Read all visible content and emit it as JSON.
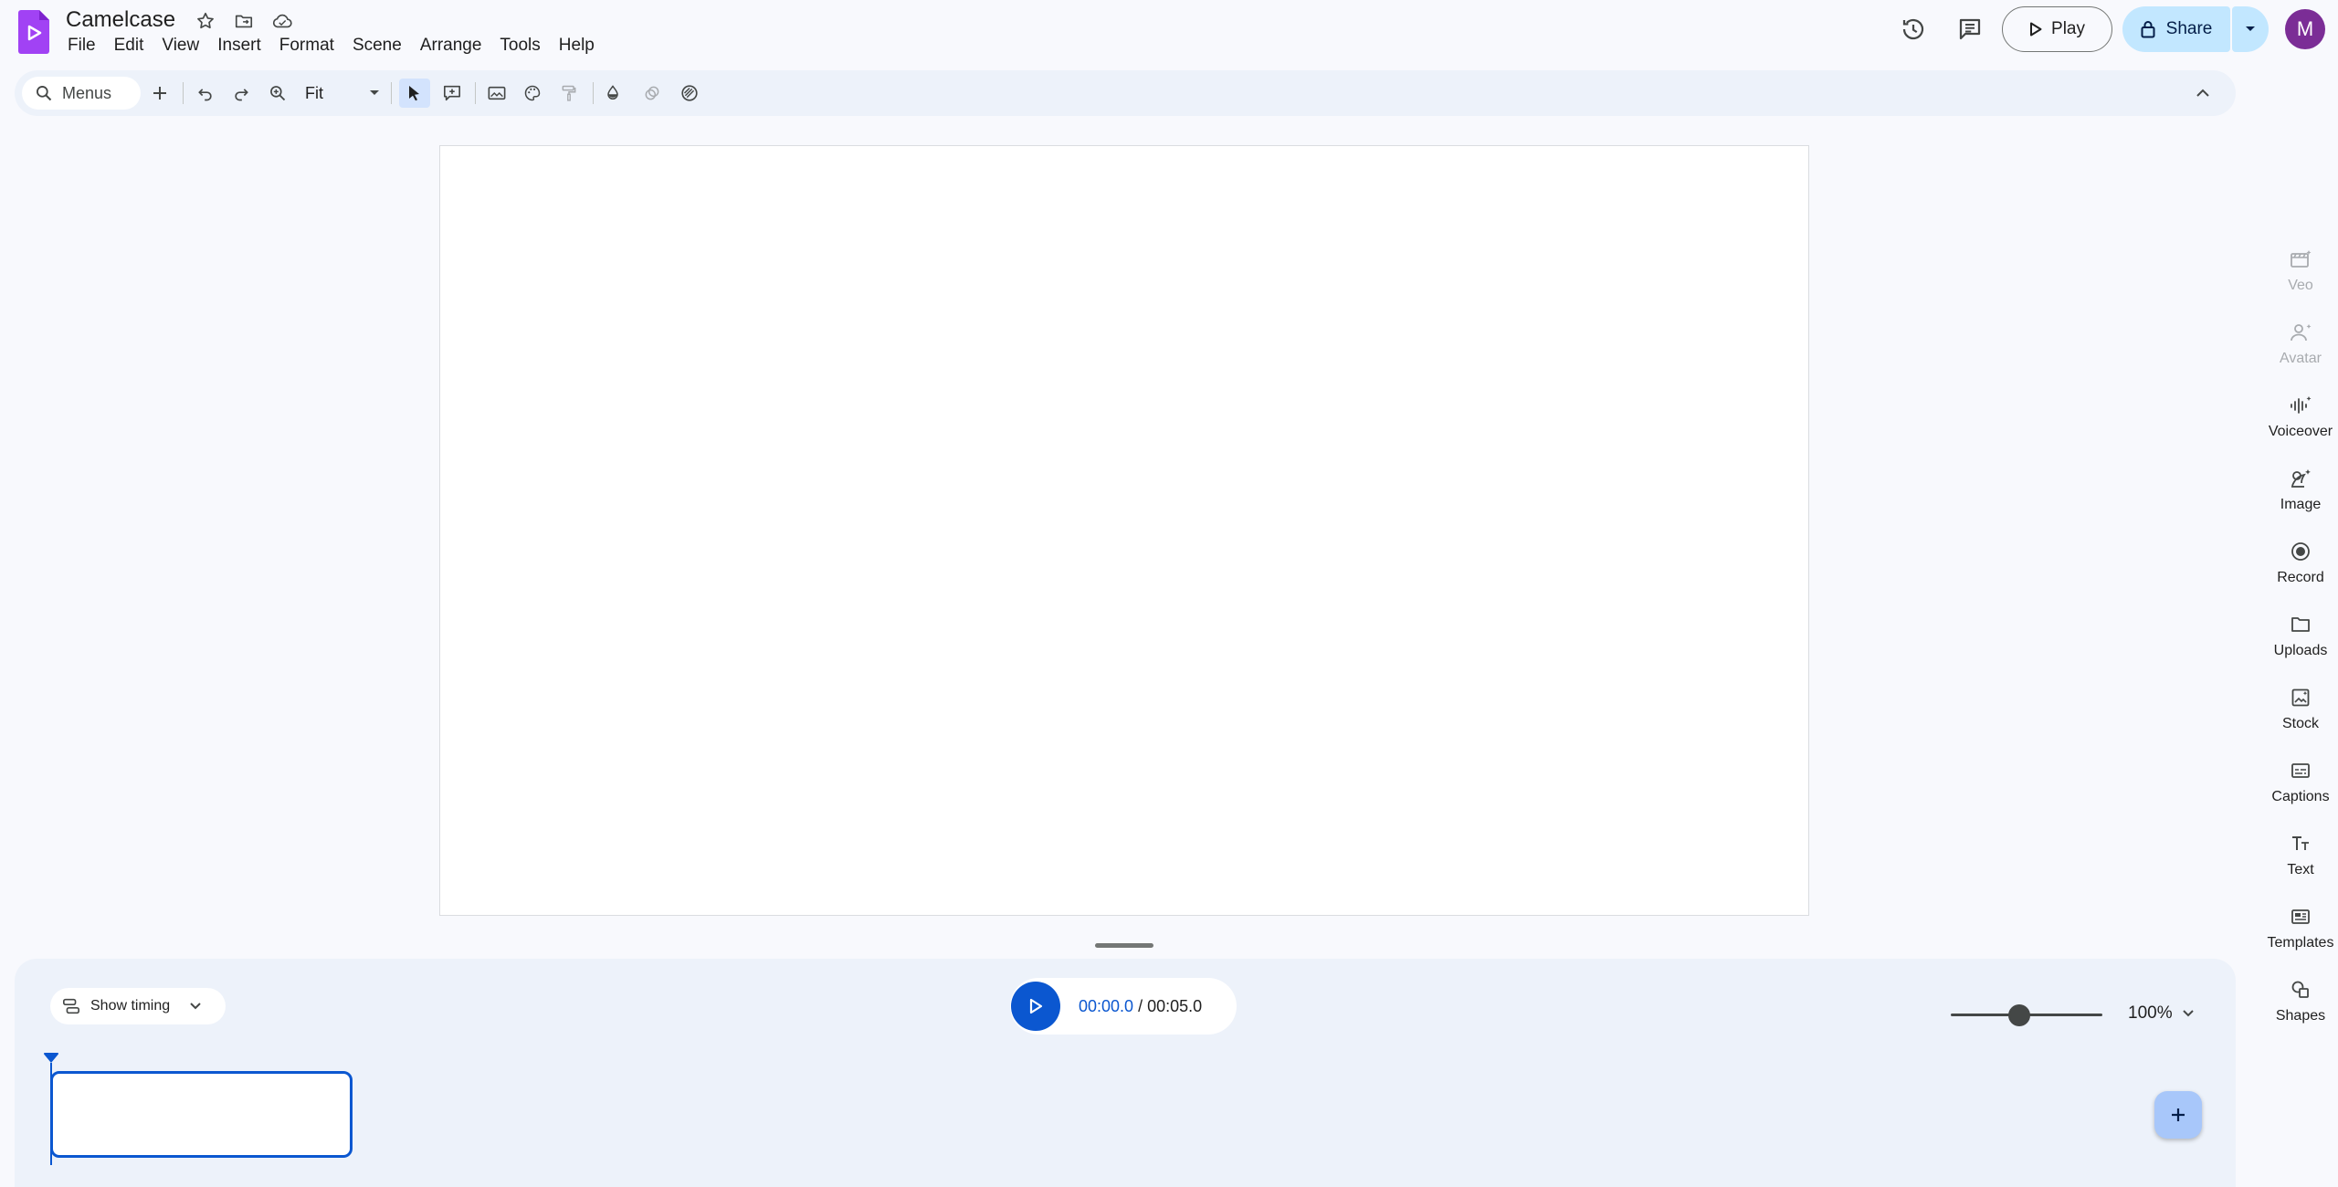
{
  "app": {
    "title": "Camelcase",
    "brand_color": "#a142f4",
    "accent": "#0b57d0"
  },
  "menu": {
    "items": [
      "File",
      "Edit",
      "View",
      "Insert",
      "Format",
      "Scene",
      "Arrange",
      "Tools",
      "Help"
    ]
  },
  "header": {
    "play_label": "Play",
    "share_label": "Share",
    "avatar_initial": "M"
  },
  "toolbar": {
    "search_label": "Menus",
    "zoom_value": "Fit"
  },
  "side_panel": {
    "items": [
      {
        "label": "Veo",
        "icon": "veo-icon",
        "enabled": false
      },
      {
        "label": "Avatar",
        "icon": "avatar-icon",
        "enabled": false
      },
      {
        "label": "Voiceover",
        "icon": "voiceover-icon",
        "enabled": true
      },
      {
        "label": "Image",
        "icon": "image-icon",
        "enabled": true
      },
      {
        "label": "Record",
        "icon": "record-icon",
        "enabled": true
      },
      {
        "label": "Uploads",
        "icon": "folder-icon",
        "enabled": true
      },
      {
        "label": "Stock",
        "icon": "stock-icon",
        "enabled": true
      },
      {
        "label": "Captions",
        "icon": "captions-icon",
        "enabled": true
      },
      {
        "label": "Text",
        "icon": "text-icon",
        "enabled": true
      },
      {
        "label": "Templates",
        "icon": "templates-icon",
        "enabled": true
      },
      {
        "label": "Shapes",
        "icon": "shapes-icon",
        "enabled": true
      }
    ]
  },
  "timeline": {
    "show_timing_label": "Show timing",
    "current_time": "00:00.0",
    "separator": "/",
    "total_time": "00:05.0",
    "zoom_percent": "100%",
    "zoom_level": 0.45
  }
}
